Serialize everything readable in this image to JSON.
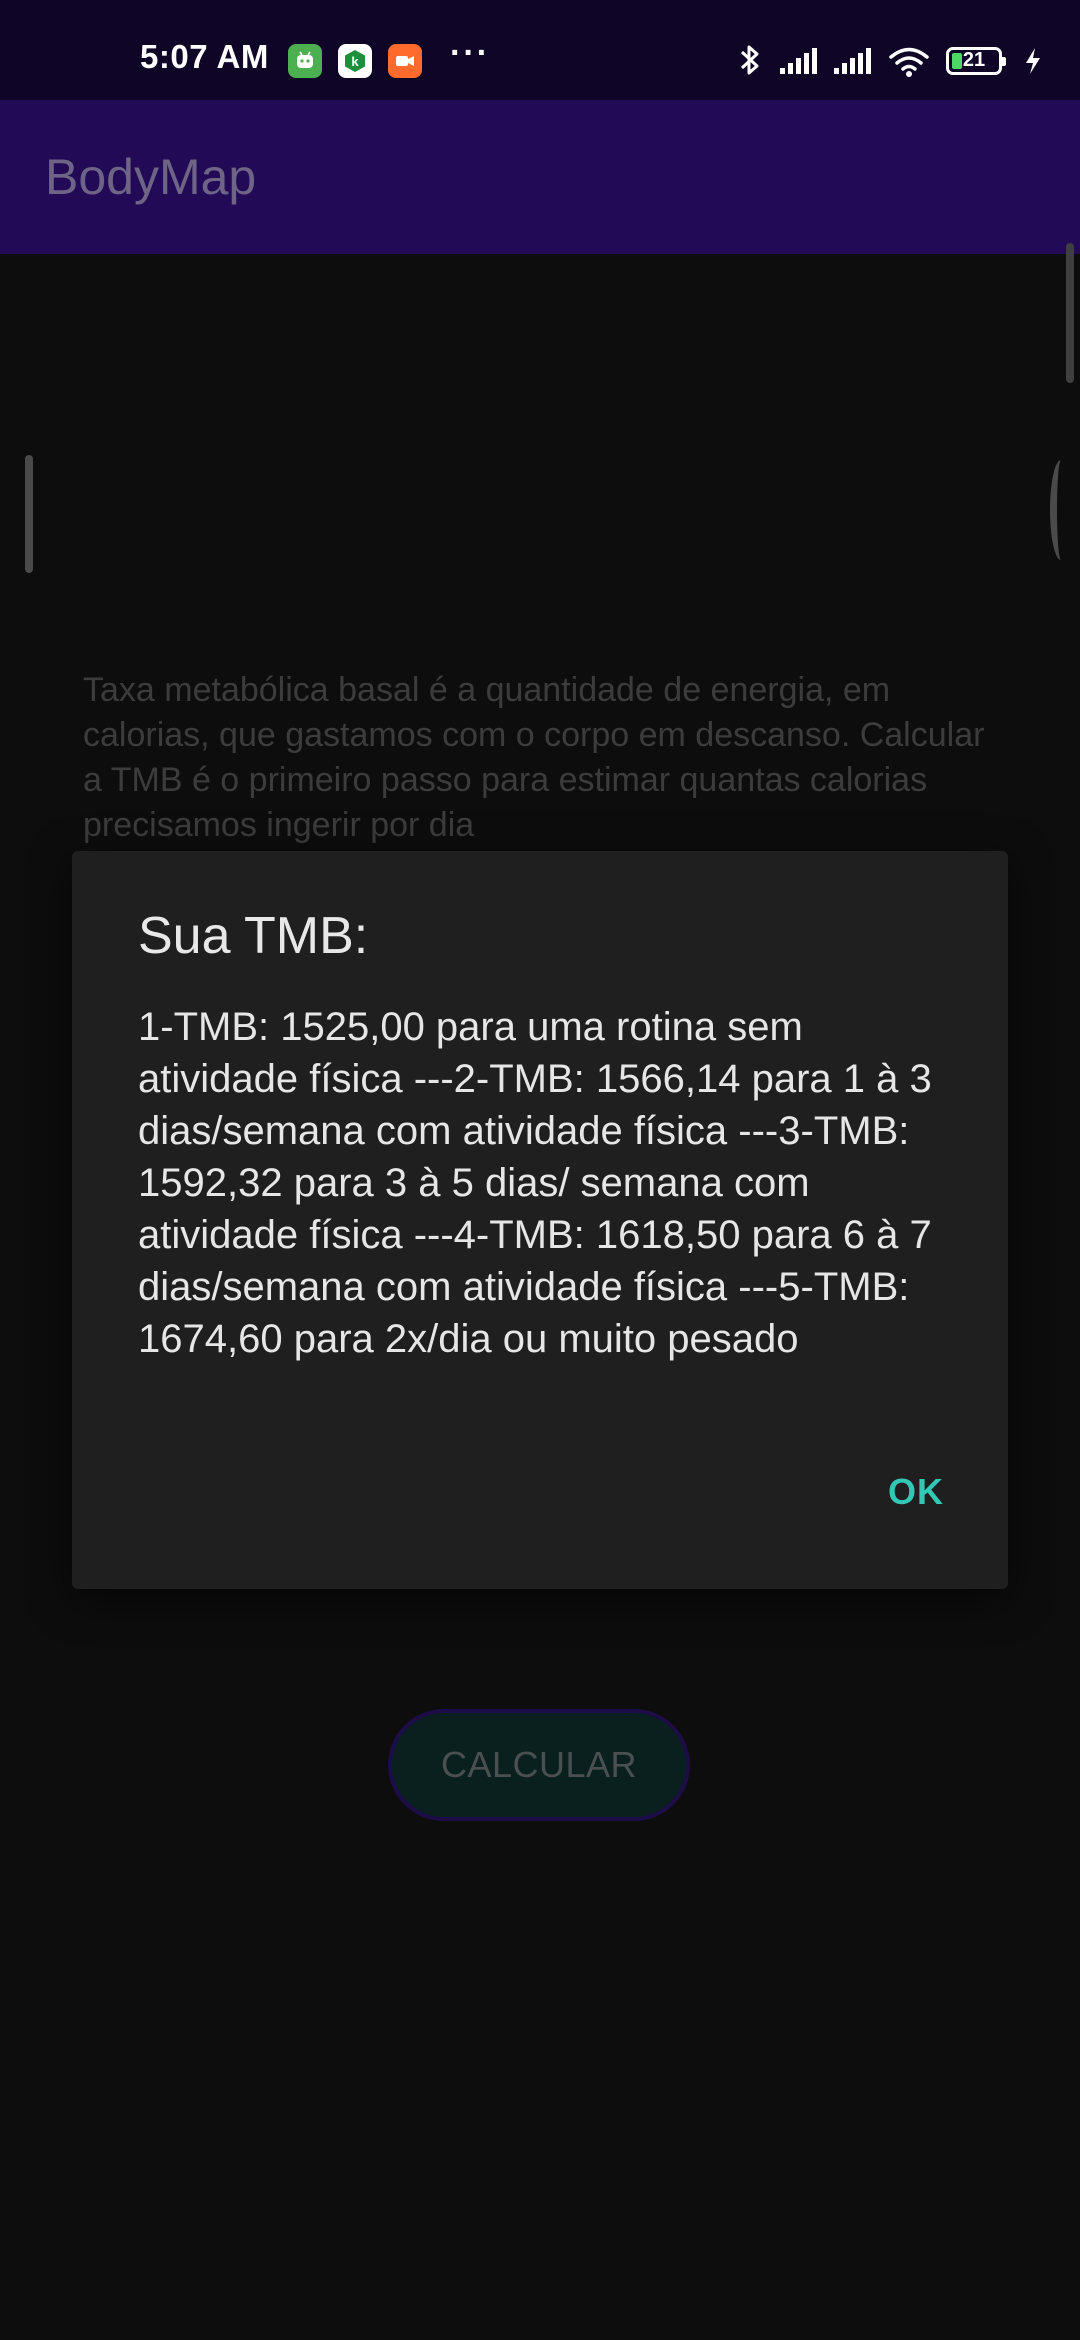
{
  "status_bar": {
    "time": "5:07 AM",
    "notification_icons": [
      "android-app-icon",
      "kaspersky-app-icon",
      "video-recorder-icon"
    ],
    "overflow": "···",
    "battery_level": "21",
    "icons": [
      "bluetooth-icon",
      "signal-1-icon",
      "signal-2-icon",
      "wifi-icon",
      "battery-icon",
      "charging-icon"
    ]
  },
  "app_bar": {
    "title": "BodyMap"
  },
  "main": {
    "description": "Taxa metabólica basal é a quantidade de energia, em calorias, que gastamos com o corpo em descanso. Calcular a TMB é o primeiro passo para estimar quantas calorias precisamos ingerir por dia",
    "calculate_button": "CALCULAR"
  },
  "dialog": {
    "title": "Sua TMB:",
    "message": "1-TMB: 1525,00 para uma rotina sem atividade física ---2-TMB: 1566,14 para 1 à 3 dias/semana com atividade física ---3-TMB: 1592,32 para 3 à 5 dias/ semana com atividade física ---4-TMB: 1618,50 para 6 à 7 dias/semana com atividade física ---5-TMB: 1674,60 para 2x/dia ou muito pesado",
    "ok_button": "OK"
  },
  "colors": {
    "status_bar_bg": "#0f0627",
    "app_bar_bg": "#230a57",
    "background": "#0d0d0d",
    "dialog_bg": "#1f1f1f",
    "accent": "#33c8b6"
  }
}
